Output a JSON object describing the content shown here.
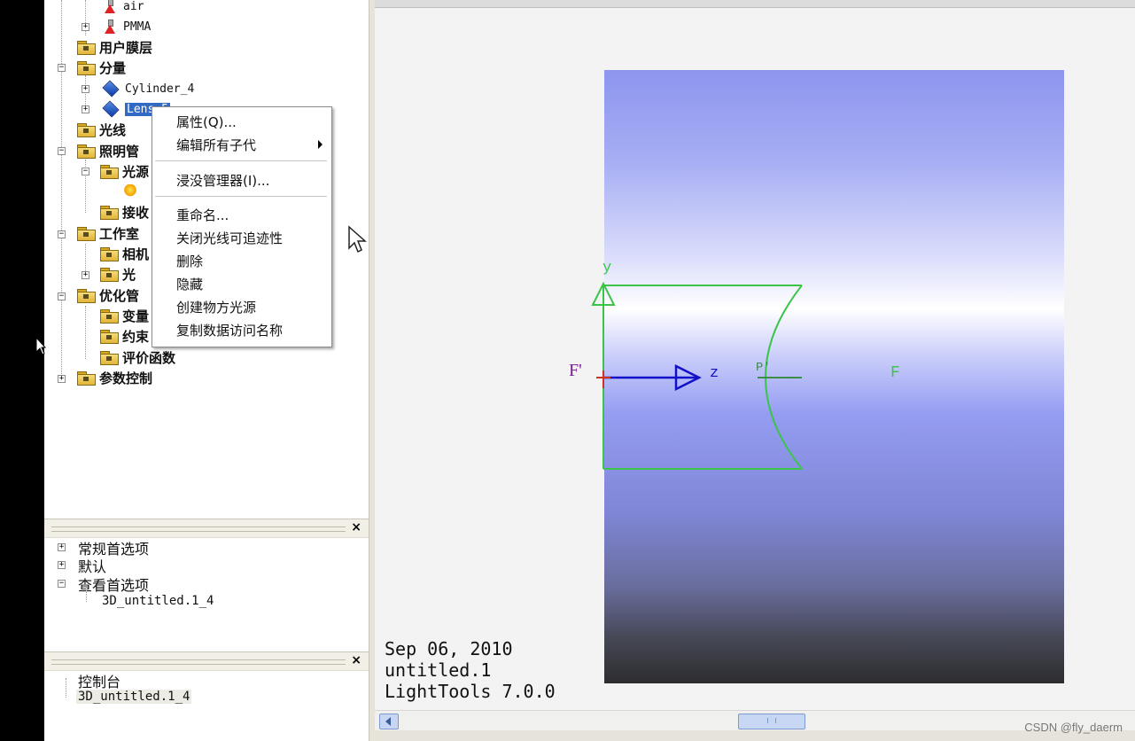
{
  "tree": {
    "items": [
      {
        "label": "air"
      },
      {
        "label": "PMMA"
      },
      {
        "label": "用户膜层"
      },
      {
        "label": "分量"
      },
      {
        "label": "Cylinder_4"
      },
      {
        "label": "Lens_5"
      },
      {
        "label": "光线"
      },
      {
        "label": "照明管"
      },
      {
        "label": "光源"
      },
      {
        "label": "接收"
      },
      {
        "label": "工作室"
      },
      {
        "label": "相机"
      },
      {
        "label": "光"
      },
      {
        "label": "优化管"
      },
      {
        "label": "变量"
      },
      {
        "label": "约束"
      },
      {
        "label": "评价函数"
      },
      {
        "label": "参数控制"
      }
    ]
  },
  "context_menu": {
    "items": [
      {
        "label": "属性(Q)..."
      },
      {
        "label": "编辑所有子代"
      },
      {
        "label": "浸没管理器(I)..."
      },
      {
        "label": "重命名..."
      },
      {
        "label": "关闭光线可追迹性"
      },
      {
        "label": "删除"
      },
      {
        "label": "隐藏"
      },
      {
        "label": "创建物方光源"
      },
      {
        "label": "复制数据访问名称"
      }
    ]
  },
  "prefs_panel": {
    "close": "×",
    "items": [
      {
        "label": "常规首选项"
      },
      {
        "label": "默认"
      },
      {
        "label": "查看首选项"
      },
      {
        "label": "3D_untitled.1_4"
      }
    ]
  },
  "console_panel": {
    "close": "×",
    "items": [
      {
        "label": "控制台"
      },
      {
        "label": "3D_untitled.1_4"
      }
    ]
  },
  "viewport": {
    "axis_y": "y",
    "axis_z": "z",
    "focal_left": "F'",
    "focal_right": "F",
    "principal": "P'",
    "info_date": "Sep 06, 2010",
    "info_file": "untitled.1",
    "info_app": "LightTools 7.0.0"
  },
  "watermark": "CSDN @fly_daerm",
  "colors": {
    "lens_outline": "#3cc44a",
    "axis_blue": "#1010c8",
    "focal_purple": "#7a1a9a",
    "selection": "#316ac5"
  }
}
